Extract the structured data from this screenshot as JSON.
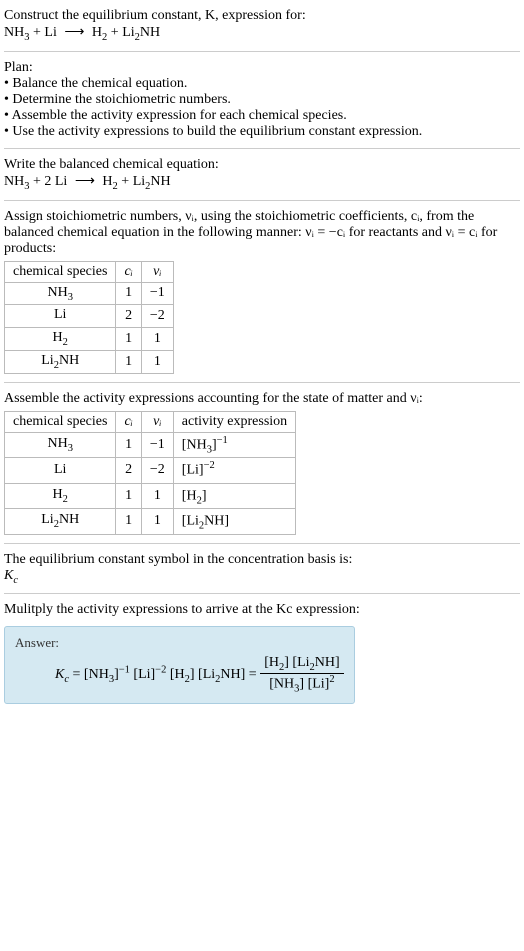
{
  "prompt": {
    "line1": "Construct the equilibrium constant, K, expression for:",
    "eq_reactant1": "NH",
    "eq_reactant1_sub": "3",
    "plus1": " + ",
    "eq_reactant2": "Li",
    "arrow": "⟶",
    "eq_product1": "H",
    "eq_product1_sub": "2",
    "plus2": " + ",
    "eq_product2": "Li",
    "eq_product2_sub": "2",
    "eq_product2_tail": "NH"
  },
  "plan": {
    "heading": "Plan:",
    "b1": "• Balance the chemical equation.",
    "b2": "• Determine the stoichiometric numbers.",
    "b3": "• Assemble the activity expression for each chemical species.",
    "b4": "• Use the activity expressions to build the equilibrium constant expression."
  },
  "balanced": {
    "heading": "Write the balanced chemical equation:",
    "r1": "NH",
    "r1s": "3",
    "plus1": " + 2 Li ",
    "arrow": "⟶",
    "p1": " H",
    "p1s": "2",
    "plus2": " + ",
    "p2": "Li",
    "p2s": "2",
    "p2tail": "NH"
  },
  "stoich": {
    "intro": "Assign stoichiometric numbers, νᵢ, using the stoichiometric coefficients, cᵢ, from the balanced chemical equation in the following manner: νᵢ = −cᵢ for reactants and νᵢ = cᵢ for products:",
    "headers": {
      "a": "chemical species",
      "b": "cᵢ",
      "c": "νᵢ"
    },
    "rows": [
      {
        "sp_a": "NH",
        "sp_sub": "3",
        "sp_b": "",
        "c": "1",
        "v": "−1"
      },
      {
        "sp_a": "Li",
        "sp_sub": "",
        "sp_b": "",
        "c": "2",
        "v": "−2"
      },
      {
        "sp_a": "H",
        "sp_sub": "2",
        "sp_b": "",
        "c": "1",
        "v": "1"
      },
      {
        "sp_a": "Li",
        "sp_sub": "2",
        "sp_b": "NH",
        "c": "1",
        "v": "1"
      }
    ]
  },
  "activity": {
    "intro": "Assemble the activity expressions accounting for the state of matter and νᵢ:",
    "headers": {
      "a": "chemical species",
      "b": "cᵢ",
      "c": "νᵢ",
      "d": "activity expression"
    },
    "rows": [
      {
        "sp_a": "NH",
        "sp_sub": "3",
        "sp_b": "",
        "c": "1",
        "v": "−1",
        "act_a": "[NH",
        "act_sub": "3",
        "act_b": "]",
        "act_sup": "−1"
      },
      {
        "sp_a": "Li",
        "sp_sub": "",
        "sp_b": "",
        "c": "2",
        "v": "−2",
        "act_a": "[Li]",
        "act_sub": "",
        "act_b": "",
        "act_sup": "−2"
      },
      {
        "sp_a": "H",
        "sp_sub": "2",
        "sp_b": "",
        "c": "1",
        "v": "1",
        "act_a": "[H",
        "act_sub": "2",
        "act_b": "]",
        "act_sup": ""
      },
      {
        "sp_a": "Li",
        "sp_sub": "2",
        "sp_b": "NH",
        "c": "1",
        "v": "1",
        "act_a": "[Li",
        "act_sub": "2",
        "act_b": "NH]",
        "act_sup": ""
      }
    ]
  },
  "symbol": {
    "line1": "The equilibrium constant symbol in the concentration basis is:",
    "Kc_base": "K",
    "Kc_sub": "c"
  },
  "multiply": {
    "line": "Mulitply the activity expressions to arrive at the Kc expression:"
  },
  "answer": {
    "label": "Answer:",
    "lhs_K": "K",
    "lhs_c": "c",
    "eq": " = ",
    "t1a": "[NH",
    "t1sub": "3",
    "t1b": "]",
    "t1sup": "−1",
    "sp1": " ",
    "t2a": "[Li]",
    "t2sup": "−2",
    "sp2": " ",
    "t3a": "[H",
    "t3sub": "2",
    "t3b": "]",
    "sp3": " ",
    "t4a": "[Li",
    "t4sub": "2",
    "t4b": "NH]",
    "eq2": " = ",
    "num1a": "[H",
    "num1sub": "2",
    "num1b": "] ",
    "num2a": "[Li",
    "num2sub": "2",
    "num2b": "NH]",
    "den1a": "[NH",
    "den1sub": "3",
    "den1b": "] ",
    "den2a": "[Li]",
    "den2sup": "2"
  }
}
